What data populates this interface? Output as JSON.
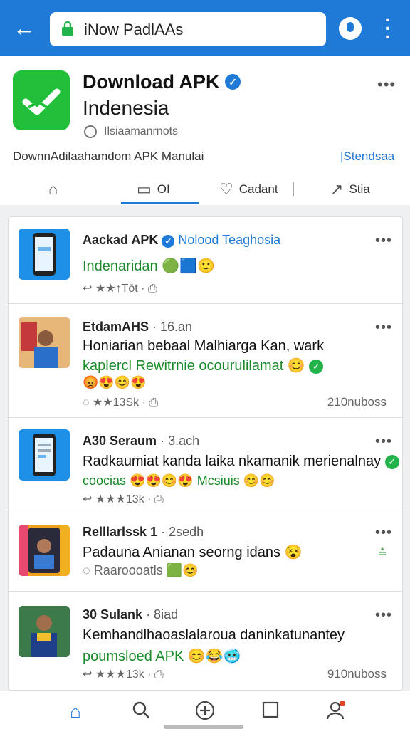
{
  "topbar": {
    "back_icon": "arrow-left-icon",
    "url_text": "iNow PadlAAs",
    "lock_icon": "lock-icon",
    "mic_icon": "mic-icon",
    "menu_icon": "kebab-icon",
    "color": "#1e7ad6"
  },
  "header": {
    "title": "Download APK",
    "subtitle": "Indenesia",
    "meta": "Ilsiaamanrnots",
    "description": "DownnAdilaahamdom APK Manulai",
    "link": "|Stendsaa",
    "actions": [
      {
        "icon": "home-icon",
        "label": ""
      },
      {
        "icon": "chat-icon",
        "label": "OI"
      },
      {
        "icon": "heart-icon",
        "label": "Cadant"
      },
      {
        "icon": "share-icon",
        "label": "Stia"
      }
    ]
  },
  "posts": [
    {
      "name": "Aackad APK",
      "channel": "Nolood Teaghosia",
      "green": "Indenaridan",
      "stats": "★★↑Tōt",
      "right": ""
    },
    {
      "name": "EtdamAHS",
      "time": "· 16.an",
      "text": "Honiarian bebaal Malhiarga Kan, wark",
      "green": "kaplercl Rewitrnie ocourulilamat",
      "stats": "★★13Sk ·",
      "right": "210nuboss"
    },
    {
      "name": "A30 Seraum",
      "time": "· 3.ach",
      "text": "Radkaumiat kanda laika nkamanik merienalnay",
      "green": "coocias",
      "green2": "Mcsiuis",
      "stats": "★★★13k ·",
      "right": ""
    },
    {
      "name": "Relllarlssk 1",
      "time": "· 2sedh",
      "text": "Padauna Anianan seorng idans",
      "green": "",
      "stats": "Raaroooatls",
      "right": ""
    },
    {
      "name": "30 Sulank",
      "time": "· 8iad",
      "text": "Kemhandlhaoaslalaroua daninkatunantey",
      "green": "poumsloed APK",
      "stats": "★★★13k ·",
      "right": "910nuboss"
    }
  ],
  "bottomnav": [
    {
      "icon": "home-icon"
    },
    {
      "icon": "search-icon"
    },
    {
      "icon": "add-icon"
    },
    {
      "icon": "square-icon"
    },
    {
      "icon": "profile-icon"
    }
  ]
}
